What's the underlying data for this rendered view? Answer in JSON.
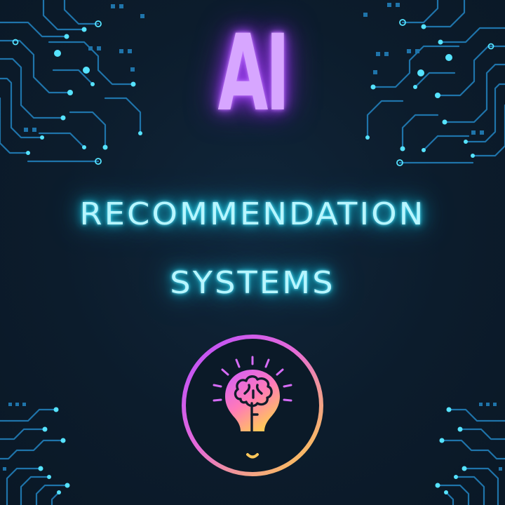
{
  "poster": {
    "title": "AI",
    "subtitle_line1": "RECOMMENDATION",
    "subtitle_line2": "SYSTEMS"
  },
  "icons": {
    "main": "lightbulb-brain-icon",
    "decor_top_left": "circuit-pattern",
    "decor_top_right": "circuit-pattern",
    "decor_bottom_left": "circuit-pattern",
    "decor_bottom_right": "circuit-pattern"
  },
  "colors": {
    "background": "#0c1b2a",
    "title_glow": "#c77dff",
    "subtitle_glow": "#22d3ee",
    "circuit_line": "#1e6fa3",
    "circuit_node": "#5fe3ff",
    "ring_gradient_start": "#c04bff",
    "ring_gradient_end": "#ffd23f"
  }
}
